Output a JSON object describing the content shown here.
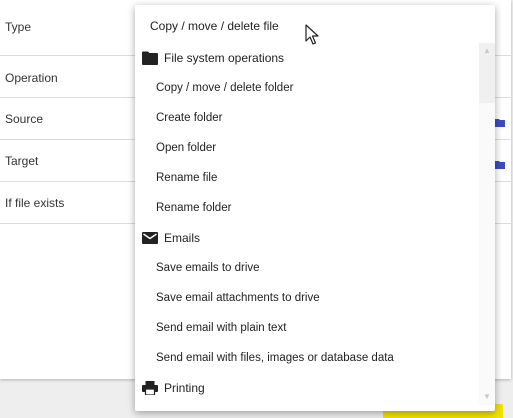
{
  "form": {
    "rows": [
      {
        "label": "Type"
      },
      {
        "label": "Operation"
      },
      {
        "label": "Source"
      },
      {
        "label": "Target"
      },
      {
        "label": "If file exists"
      }
    ]
  },
  "dropdown": {
    "selected": "Copy / move / delete file",
    "groups": [
      {
        "label": "File system operations",
        "icon": "folder-icon",
        "items": [
          "Copy / move / delete folder",
          "Create folder",
          "Open folder",
          "Rename file",
          "Rename folder"
        ]
      },
      {
        "label": "Emails",
        "icon": "envelope-icon",
        "items": [
          "Save emails to drive",
          "Save email attachments to drive",
          "Send email with plain text",
          "Send email with files, images or database data"
        ]
      },
      {
        "label": "Printing",
        "icon": "printer-icon",
        "items": []
      }
    ]
  },
  "colors": {
    "accent_yellow": "#f2e100",
    "icon_blue": "#3a4cc4"
  }
}
